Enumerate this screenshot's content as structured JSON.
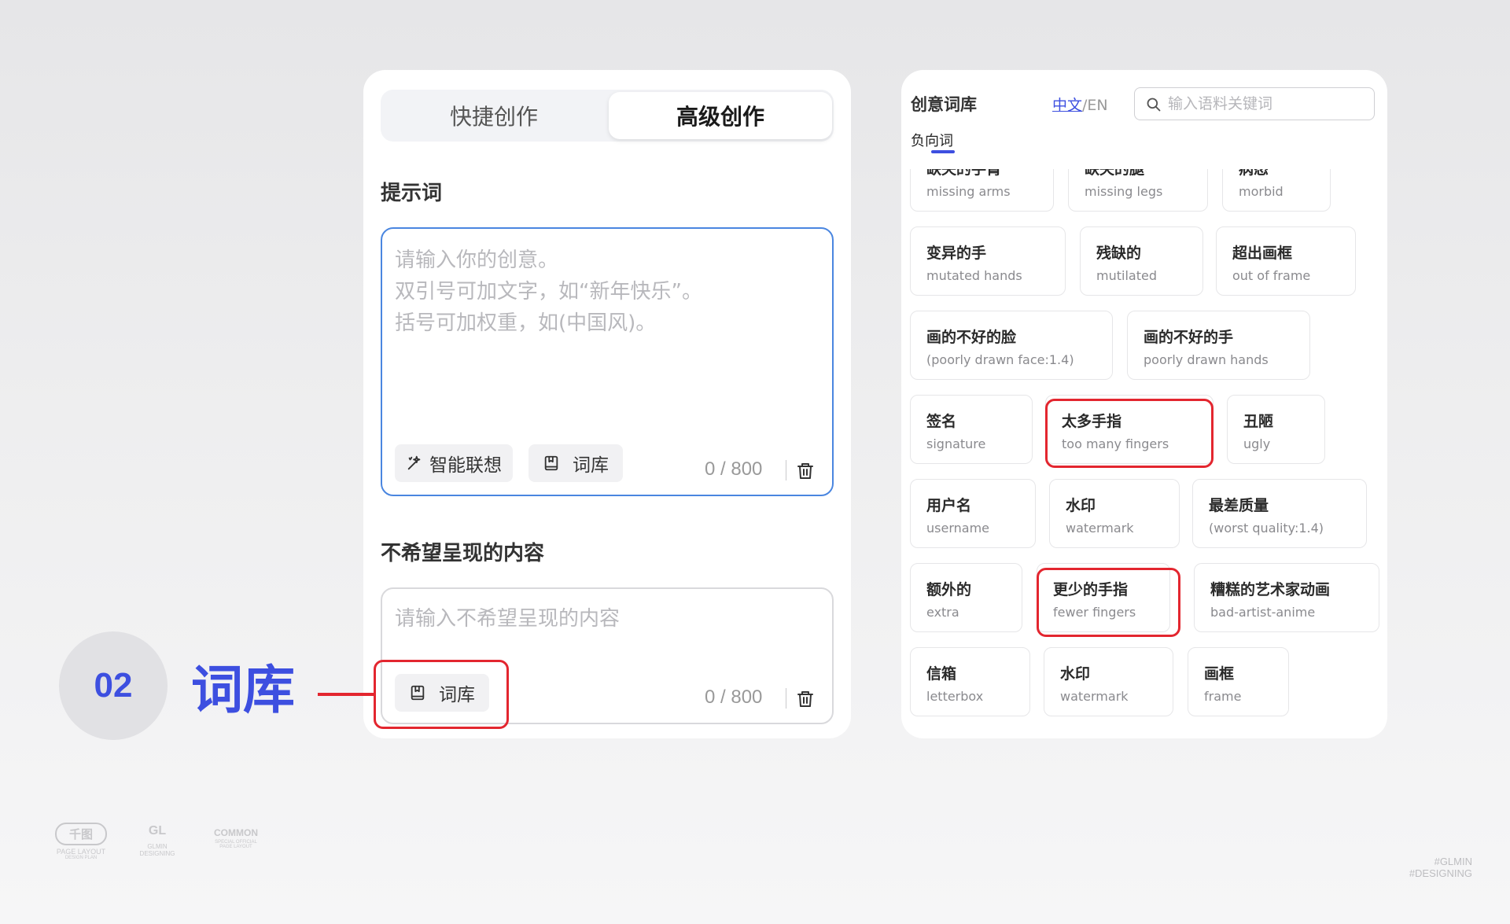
{
  "left": {
    "tabs": [
      "快捷创作",
      "高级创作"
    ],
    "prompt": {
      "title": "提示词",
      "placeholder": "请输入你的创意。\n双引号可加文字，如“新年快乐”。\n括号可加权重，如(中国风)。",
      "smart_label": "智能联想",
      "lib_label": "词库",
      "counter": "0 / 800"
    },
    "negative": {
      "title": "不希望呈现的内容",
      "placeholder": "请输入不希望呈现的内容",
      "lib_label": "词库",
      "counter": "0 / 800"
    }
  },
  "right": {
    "title": "创意词库",
    "lang_zh": "中文",
    "lang_sep": "/",
    "lang_en": "EN",
    "search_placeholder": "输入语料关键词",
    "subtab": "负向词",
    "cards": [
      {
        "zh": "缺失的手臂",
        "en": "missing arms"
      },
      {
        "zh": "缺失的腿",
        "en": "missing legs"
      },
      {
        "zh": "病态",
        "en": "morbid"
      },
      {
        "zh": "变异的手",
        "en": "mutated hands"
      },
      {
        "zh": "残缺的",
        "en": "mutilated"
      },
      {
        "zh": "超出画框",
        "en": "out of frame"
      },
      {
        "zh": "画的不好的脸",
        "en": "(poorly drawn face:1.4)"
      },
      {
        "zh": "画的不好的手",
        "en": "poorly drawn hands"
      },
      {
        "zh": "签名",
        "en": "signature"
      },
      {
        "zh": "太多手指",
        "en": "too many fingers"
      },
      {
        "zh": "丑陋",
        "en": "ugly"
      },
      {
        "zh": "用户名",
        "en": "username"
      },
      {
        "zh": "水印",
        "en": "watermark"
      },
      {
        "zh": "最差质量",
        "en": "(worst quality:1.4)"
      },
      {
        "zh": "额外的",
        "en": "extra"
      },
      {
        "zh": "更少的手指",
        "en": "fewer fingers"
      },
      {
        "zh": "糟糕的艺术家动画",
        "en": "bad-artist-anime"
      },
      {
        "zh": "信箱",
        "en": "letterbox"
      },
      {
        "zh": "水印",
        "en": "watermark"
      },
      {
        "zh": "画框",
        "en": "frame"
      }
    ]
  },
  "annotation": {
    "number": "02",
    "label": "词库"
  },
  "footer": {
    "logo1_mark": "千图",
    "logo1_text": "PAGE LAYOUT",
    "logo1_sub": "DESIGN PLAN",
    "logo2_mark": "GL",
    "logo2_text": "GLMIN",
    "logo2_sub": "DESIGNING",
    "logo3_mark": "COMMON",
    "logo3_text": "SPECIAL OFFICIAL",
    "logo3_sub": "PAGE LAYOUT",
    "corner1": "#GLMIN",
    "corner2": "#DESIGNING"
  },
  "colors": {
    "accent": "#3d4fe0",
    "highlight": "#e3262f",
    "focus_border": "#4a86e0"
  }
}
